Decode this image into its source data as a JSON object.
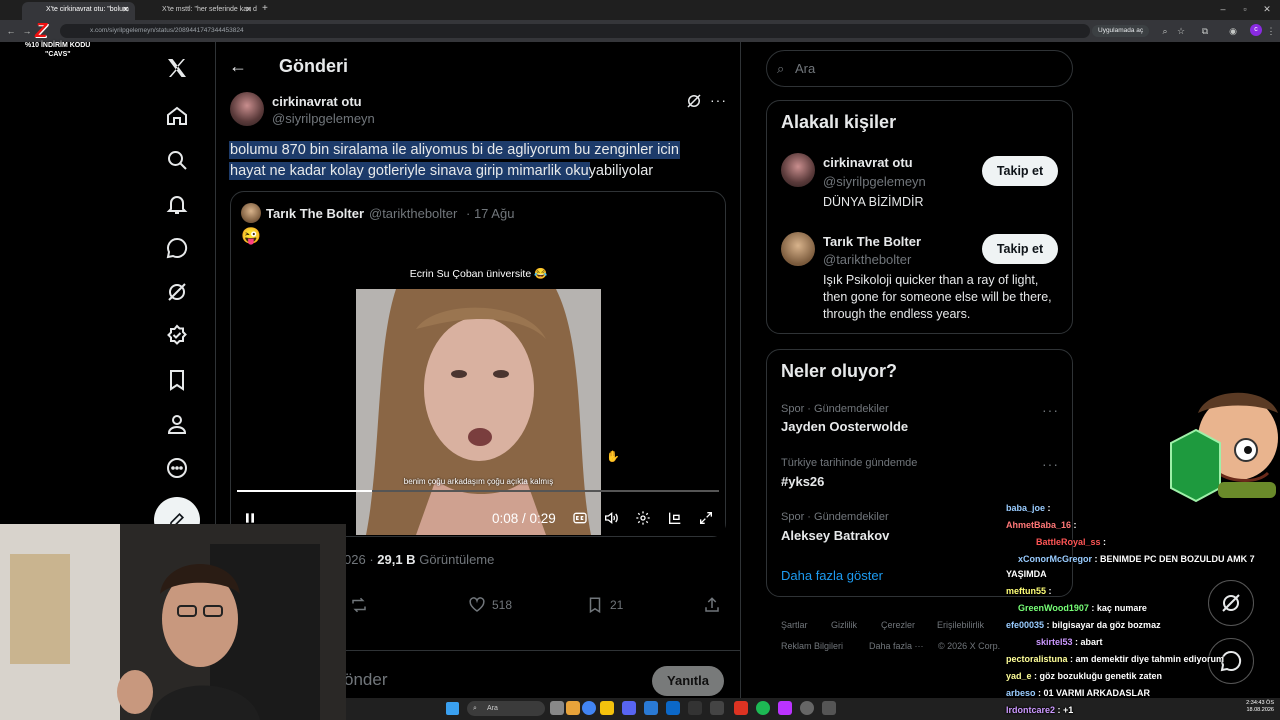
{
  "browser": {
    "tabs": [
      {
        "title": "X'te cirkinavrat otu: \"bolum"
      },
      {
        "title": "X'te msttl: \"her seferinde kan d"
      }
    ],
    "url": "x.com/siyrilpgelemeyn/status/2089441747344453824",
    "open_in_app": "Uygulamada aç"
  },
  "promo": {
    "line1": "%10 İNDİRİM KODU",
    "line2": "\"CAVS\""
  },
  "header": {
    "title": "Gönderi"
  },
  "post": {
    "author_name": "cirkinavrat otu",
    "author_handle": "@siyrilpgelemeyn",
    "text_line1": "bolumu 870 bin siralama ile aliyomus bi de agliyorum bu zenginler icin",
    "text_line2_hl": "hayat ne kadar kolay gotleriyle sinava girip mimarlik oku",
    "text_line2_rest": "yabiliyolar",
    "date_partial": "026",
    "views_count": "29,1 B",
    "views_label": "Görüntüleme",
    "likes": "518",
    "bookmarks": "21"
  },
  "quote": {
    "author_name": "Tarık The Bolter",
    "author_handle": "@tarikthebolter",
    "date": "· 17 Ağu",
    "emoji": "😜",
    "video_title": "Ecrin Su Çoban üniversite 😂",
    "subtitle": "benim çoğu arkadaşım çoğu açıkta kalmış",
    "time": "0:08 / 0:29",
    "progress": 0.28
  },
  "reply": {
    "placeholder": "önder",
    "button": "Yanıtla"
  },
  "search": {
    "placeholder": "Ara"
  },
  "related": {
    "title": "Alakalı kişiler",
    "people": [
      {
        "name": "cirkinavrat otu",
        "handle": "@siyrilpgelemeyn",
        "bio": "DÜNYA BİZİMDİR",
        "follow": "Takip et"
      },
      {
        "name": "Tarık The Bolter",
        "handle": "@tarikthebolter",
        "bio": "Işık Psikoloji quicker than a ray of light, then gone for someone else will be there, through the endless years.",
        "follow": "Takip et"
      }
    ]
  },
  "trends": {
    "title": "Neler oluyor?",
    "items": [
      {
        "meta": "Spor · Gündemdekiler",
        "name": "Jayden Oosterwolde"
      },
      {
        "meta": "Türkiye tarihinde gündemde",
        "name": "#yks26"
      },
      {
        "meta": "Spor · Gündemdekiler",
        "name": "Aleksey Batrakov"
      }
    ],
    "show_more": "Daha fazla göster"
  },
  "footer": {
    "row1": [
      "Şartlar",
      "Gizlilik",
      "Çerezler",
      "Erişilebilirlik"
    ],
    "row2": [
      "Reklam Bilgileri",
      "Daha fazla ···",
      "© 2026 X Corp."
    ]
  },
  "chat": [
    {
      "user": "baba_joe",
      "msg": ""
    },
    {
      "user": "AhmetBaba_16",
      "msg": ""
    },
    {
      "user": "BattleRoyal_ss",
      "msg": ""
    },
    {
      "user": "xConorMcGregor",
      "msg": "BENIMDE PC DEN BOZULDU AMK 7"
    },
    {
      "user": "",
      "msg": "YAŞIMDA"
    },
    {
      "user": "meftun55",
      "msg": ""
    },
    {
      "user": "GreenWood1907",
      "msg": "kaç numare"
    },
    {
      "user": "efe00035",
      "msg": "bilgisayar da göz bozmaz"
    },
    {
      "user": "skirtel53",
      "msg": "abart"
    },
    {
      "user": "pectoralistuna",
      "msg": "am demektir diye tahmin ediyorum"
    },
    {
      "user": "yad_e",
      "msg": "göz bozukluğu genetik zaten"
    },
    {
      "user": "arbeso",
      "msg": "01 VARMI ARKADASLAR"
    },
    {
      "user": "Irdontcare2",
      "msg": "+1"
    }
  ],
  "taskbar": {
    "search": "Ara",
    "time": "2:34:43 ÖS",
    "date": "18.08.2026"
  },
  "colors": {
    "accent": "#1d9bf0",
    "highlight": "#1d3b6a",
    "bg": "#000000"
  }
}
